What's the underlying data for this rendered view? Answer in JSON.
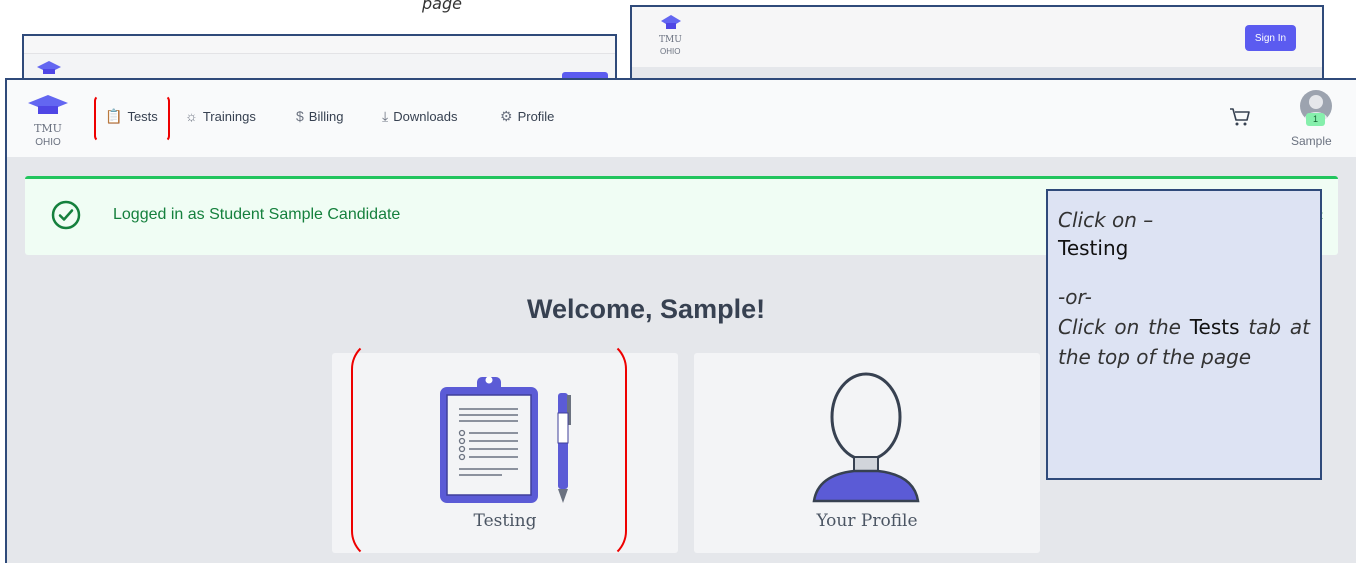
{
  "fragment_text": "page",
  "background_screens": {
    "right_logo_line1": "TMU",
    "right_logo_line2": "OHIO",
    "signin_label": "Sign In"
  },
  "header": {
    "logo_line1": "TMU",
    "logo_line2": "OHIO",
    "nav": [
      {
        "label": "Tests",
        "icon": "clipboard-icon"
      },
      {
        "label": "Trainings",
        "icon": "lightbulb-icon"
      },
      {
        "label": "Billing",
        "icon": "dollar-icon"
      },
      {
        "label": "Downloads",
        "icon": "download-icon"
      },
      {
        "label": "Profile",
        "icon": "gear-icon"
      }
    ],
    "cart_icon": "cart-icon",
    "cart_count": "1",
    "user_name": "Sample"
  },
  "alert": {
    "message": "Logged in as Student Sample Candidate",
    "close": "×"
  },
  "main": {
    "welcome": "Welcome, Sample!",
    "cards": [
      {
        "label": "Testing",
        "icon": "clipboard-checklist-icon"
      },
      {
        "label": "Your Profile",
        "icon": "person-icon"
      }
    ]
  },
  "callout": {
    "line1": "Click on –",
    "line2": "Testing",
    "line3": "-or-",
    "line4a": "Click on the ",
    "line4b": "Tests",
    "line4c": "tab at the top of the page"
  },
  "colors": {
    "accent": "#6366f1",
    "frame": "#2f4a7a",
    "success": "#15803d",
    "highlight": "#e00000",
    "callout_bg": "#dde3f3"
  }
}
